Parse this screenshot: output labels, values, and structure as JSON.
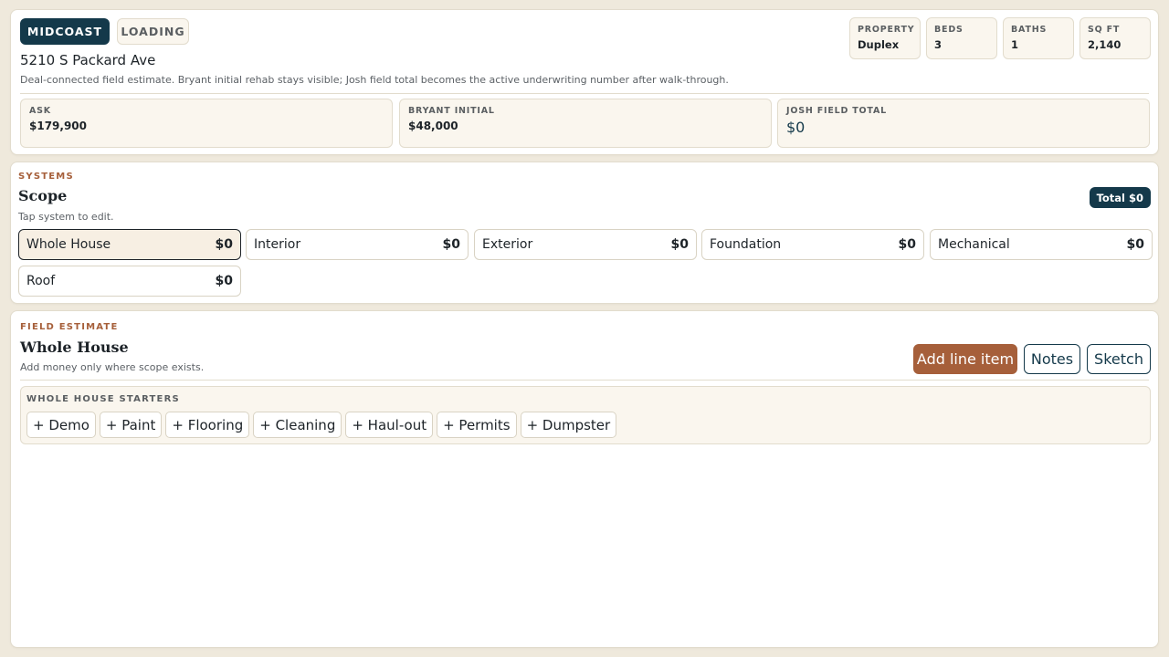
{
  "header": {
    "market": "MIDCOAST",
    "status": "LOADING",
    "address": "5210 S Packard Ave",
    "subtext": "Deal-connected field estimate. Bryant initial rehab stays visible; Josh field total becomes the active underwriting number after walk-through.",
    "stats": [
      {
        "label": "PROPERTY",
        "value": "Duplex"
      },
      {
        "label": "BEDS",
        "value": "3"
      },
      {
        "label": "BATHS",
        "value": "1"
      },
      {
        "label": "SQ FT",
        "value": "2,140"
      }
    ],
    "money": [
      {
        "label": "ASK",
        "value": "$179,900"
      },
      {
        "label": "BRYANT INITIAL",
        "value": "$48,000"
      },
      {
        "label": "JOSH FIELD TOTAL",
        "value": "$0"
      }
    ]
  },
  "systems": {
    "kicker": "SYSTEMS",
    "title": "Scope",
    "subtitle": "Tap system to edit.",
    "total_badge": "Total $0",
    "items": [
      {
        "name": "Whole House",
        "total": "$0"
      },
      {
        "name": "Interior",
        "total": "$0"
      },
      {
        "name": "Exterior",
        "total": "$0"
      },
      {
        "name": "Foundation",
        "total": "$0"
      },
      {
        "name": "Mechanical",
        "total": "$0"
      },
      {
        "name": "Roof",
        "total": "$0"
      }
    ]
  },
  "estimate": {
    "kicker": "FIELD ESTIMATE",
    "title": "Whole House",
    "subtitle": "Add money only where scope exists.",
    "add_label": "Add line item",
    "notes_label": "Notes",
    "sketch_label": "Sketch",
    "starters_label": "WHOLE HOUSE STARTERS",
    "starters": [
      "+ Demo",
      "+ Paint",
      "+ Flooring",
      "+ Cleaning",
      "+ Haul-out",
      "+ Permits",
      "+ Dumpster"
    ]
  },
  "colors": {
    "navy": "#14394a",
    "copper": "#a65f3a",
    "background": "#efe9dc",
    "panel": "#faf6ee"
  }
}
